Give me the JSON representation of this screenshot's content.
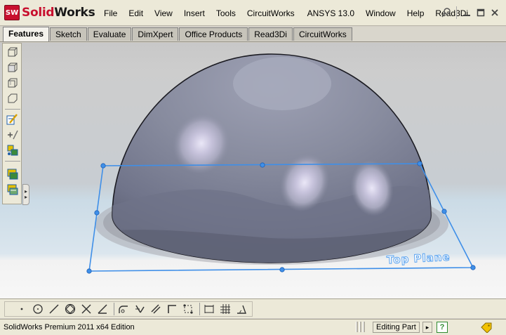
{
  "app": {
    "logo_badge": "SW",
    "logo_text_red": "Solid",
    "logo_text_dark": "Works"
  },
  "menu": [
    "File",
    "Edit",
    "View",
    "Insert",
    "Tools",
    "CircuitWorks",
    "ANSYS 13.0",
    "Window",
    "Help",
    "Read3Di"
  ],
  "window_controls": {
    "pin_icon": "pushpin-icon",
    "minimize_icon": "minimize-icon",
    "restore_icon": "restore-icon",
    "close_icon": "close-icon"
  },
  "tabs": [
    {
      "label": "Features",
      "active": true
    },
    {
      "label": "Sketch",
      "active": false
    },
    {
      "label": "Evaluate",
      "active": false
    },
    {
      "label": "DimXpert",
      "active": false
    },
    {
      "label": "Office Products",
      "active": false
    },
    {
      "label": "Read3Di",
      "active": false
    },
    {
      "label": "CircuitWorks",
      "active": false
    }
  ],
  "left_toolbar_icons": [
    "extruded-boss-icon",
    "revolved-boss-icon",
    "swept-boss-icon",
    "lofted-boss-icon",
    "sketch-edit-icon",
    "smart-dimension-icon",
    "reference-geometry-icon",
    "instant3d-icon",
    "rapid-sketch-icon"
  ],
  "viewport": {
    "plane_label": "Top Plane",
    "colors": {
      "dome_dark": "#5e6272",
      "dome_mid": "#878b9e",
      "dome_light": "#a6a8bb",
      "highlight": "#e2dff2",
      "plane_line": "#3f8fe8"
    }
  },
  "sketch_toolbar_icons": [
    "point-icon",
    "circle-icon",
    "line-icon",
    "polygon-icon",
    "trim-icon",
    "extend-icon",
    "fillet-icon",
    "convert-entities-icon",
    "offset-entities-icon",
    "corner-rectangle-icon",
    "centerline-icon",
    "dimension-icon",
    "grid-icon",
    "angle-icon"
  ],
  "statusbar": {
    "edition": "SolidWorks Premium 2011 x64 Edition",
    "mode": "Editing Part",
    "help_glyph": "?",
    "arrow_glyph": "▸",
    "tag_icon": "tag-icon"
  }
}
